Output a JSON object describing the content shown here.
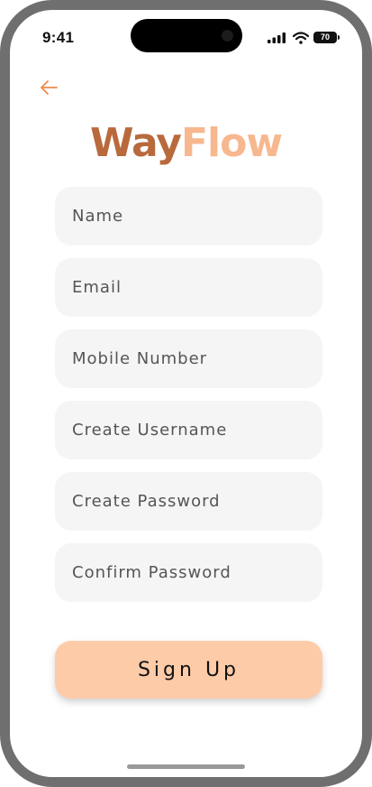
{
  "status_bar": {
    "time": "9:41",
    "battery": "70"
  },
  "logo": {
    "part1": "Way",
    "part2": "Flow"
  },
  "form": {
    "name_placeholder": "Name",
    "email_placeholder": "Email",
    "mobile_placeholder": "Mobile Number",
    "username_placeholder": "Create Username",
    "password_placeholder": "Create Password",
    "confirm_placeholder": "Confirm Password",
    "submit_label": "Sign Up"
  },
  "icons": {
    "back": "arrow-left-icon",
    "signal": "cellular-signal-icon",
    "wifi": "wifi-icon",
    "battery": "battery-icon"
  },
  "colors": {
    "accent": "#f08a4b",
    "logo_dark": "#b86a3c",
    "logo_light": "#f7b78f",
    "button": "#fecba9",
    "field_bg": "#f5f5f5"
  }
}
